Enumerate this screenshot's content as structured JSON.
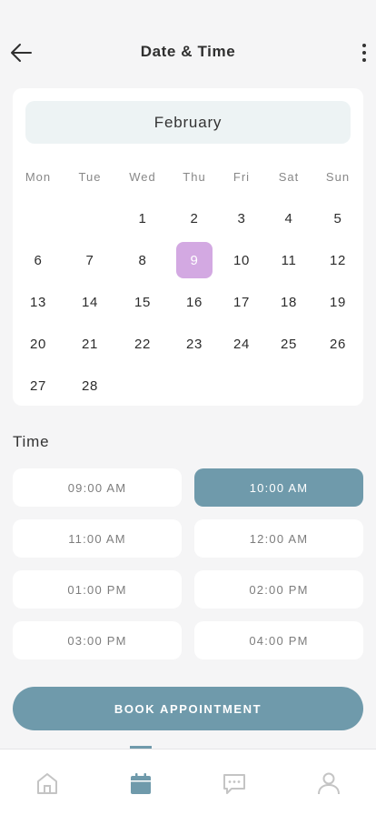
{
  "header": {
    "title": "Date & Time",
    "back_icon": "arrow-left-icon",
    "more_icon": "more-vertical-icon"
  },
  "calendar": {
    "month": "February",
    "weekdays": [
      "Mon",
      "Tue",
      "Wed",
      "Thu",
      "Fri",
      "Sat",
      "Sun"
    ],
    "days": [
      "1",
      "2",
      "3",
      "4",
      "5",
      "6",
      "7",
      "8",
      "9",
      "10",
      "11",
      "12",
      "13",
      "14",
      "15",
      "16",
      "17",
      "18",
      "19",
      "20",
      "21",
      "22",
      "23",
      "24",
      "25",
      "26",
      "27",
      "28"
    ],
    "selected_day": "9"
  },
  "time": {
    "label": "Time",
    "slots": [
      "09:00 AM",
      "10:00 AM",
      "11:00 AM",
      "12:00 AM",
      "01:00 PM",
      "02:00 PM",
      "03:00 PM",
      "04:00 PM"
    ],
    "selected_slot": "10:00 AM"
  },
  "book_button": "BOOK APPOINTMENT",
  "bottom_nav": {
    "items": [
      "home-icon",
      "calendar-icon",
      "chat-icon",
      "profile-icon"
    ],
    "active": "calendar-icon"
  },
  "colors": {
    "accent": "#6f9aab",
    "selected_day": "#d3a9e2",
    "month_bar": "#edf3f4",
    "background": "#f5f5f6"
  }
}
